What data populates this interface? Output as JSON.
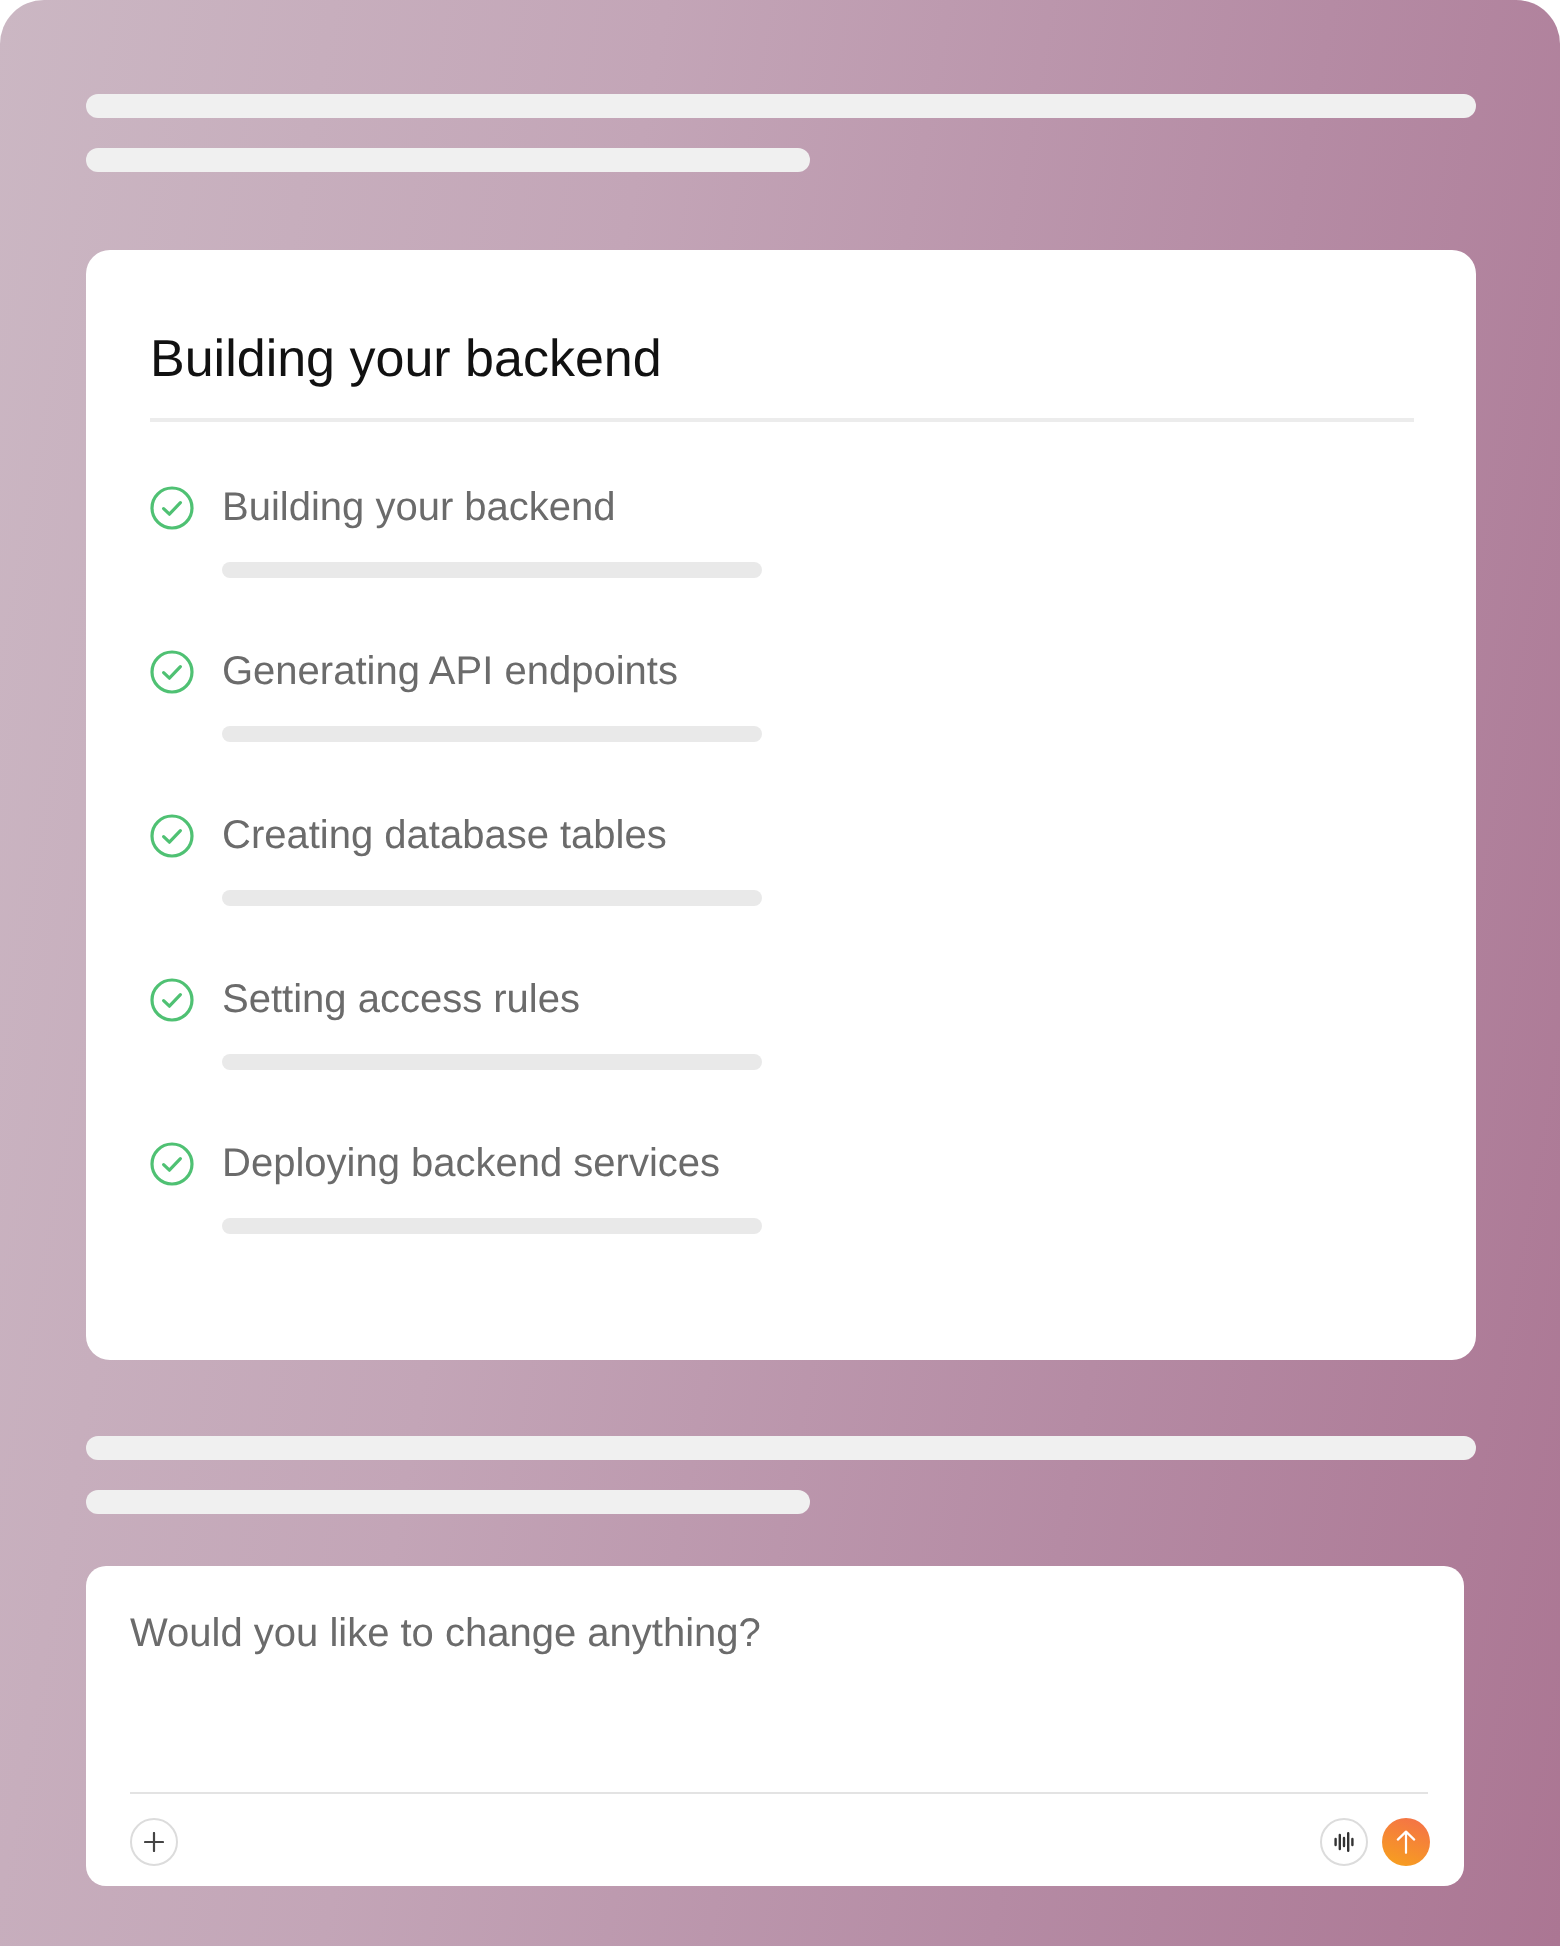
{
  "card": {
    "title": "Building your backend",
    "steps": [
      {
        "label": "Building your backend",
        "completed": true
      },
      {
        "label": "Generating API endpoints",
        "completed": true
      },
      {
        "label": "Creating database tables",
        "completed": true
      },
      {
        "label": "Setting access rules",
        "completed": true
      },
      {
        "label": "Deploying backend services",
        "completed": true
      }
    ]
  },
  "composer": {
    "placeholder": "Would you like to change anything?"
  }
}
